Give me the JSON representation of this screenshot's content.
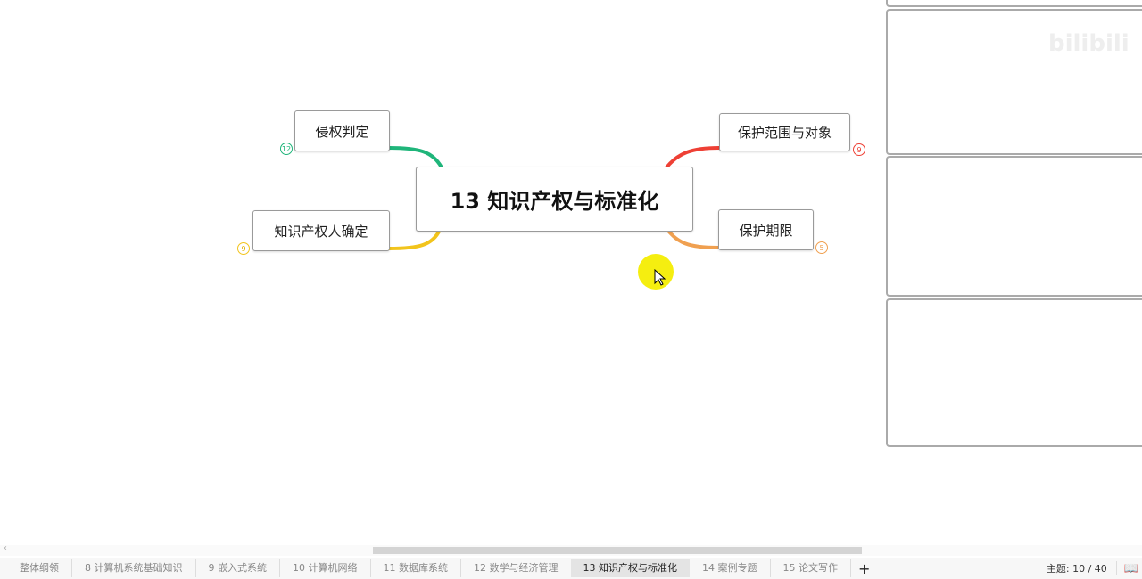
{
  "mindmap": {
    "center": "13 知识产权与标准化",
    "branches": [
      {
        "label": "侵权判定",
        "count": "12",
        "color": "#1fb57a"
      },
      {
        "label": "知识产权人确定",
        "count": "9",
        "color": "#f2c41c"
      },
      {
        "label": "保护范围与对象",
        "count": "9",
        "color": "#ee4035"
      },
      {
        "label": "保护期限",
        "count": "5",
        "color": "#f0a050"
      }
    ]
  },
  "tabs": [
    {
      "label": "整体纲领"
    },
    {
      "label": "8 计算机系统基础知识"
    },
    {
      "label": "9 嵌入式系统"
    },
    {
      "label": "10 计算机网络"
    },
    {
      "label": "11 数据库系统"
    },
    {
      "label": "12 数学与经济管理"
    },
    {
      "label": "13 知识产权与标准化"
    },
    {
      "label": "14 案例专题"
    },
    {
      "label": "15 论文写作"
    }
  ],
  "add_tab": "+",
  "status": {
    "topics": "主题: 10 / 40"
  },
  "watermark": "bilibili"
}
